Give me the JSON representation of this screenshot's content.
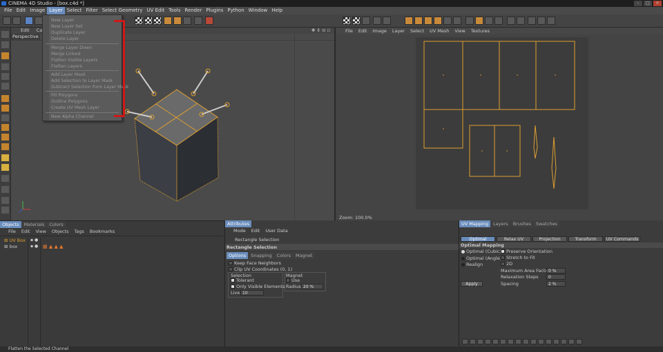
{
  "app": {
    "title": "CINEMA 4D Studio - [box.c4d *]"
  },
  "menubar": [
    "File",
    "Edit",
    "Image",
    "Layer",
    "Select",
    "Filter",
    "Select Geometry",
    "UV Edit",
    "Tools",
    "Render",
    "Plugins",
    "Python",
    "Window",
    "Help"
  ],
  "viewport": {
    "menu": [
      "Edit",
      "Cam"
    ],
    "label": "Perspective"
  },
  "layer_menu": {
    "items": [
      "New Layer",
      "New Layer Set",
      "Duplicate Layer",
      "Delete Layer",
      "Merge Layer Down",
      "Merge Linked",
      "Flatten Visible Layers",
      "Flatten Layers",
      "Add Layer Mask",
      "Add Selection to Layer Mask",
      "Subtract Selection from Layer Mask",
      "Fill Polygons",
      "Outline Polygons",
      "Create UV Mesh Layer",
      "New Alpha Channel"
    ]
  },
  "uv_view": {
    "menu": [
      "File",
      "Edit",
      "Image",
      "Layer",
      "Select",
      "UV Mesh",
      "View",
      "Textures"
    ],
    "zoom": "Zoom: 100.0%"
  },
  "objects_panel": {
    "tabs": [
      "Objects",
      "Materials",
      "Colors"
    ],
    "menu": [
      "File",
      "Edit",
      "View",
      "Objects",
      "Tags",
      "Bookmarks"
    ],
    "rows": [
      "UV Box",
      "box"
    ]
  },
  "attributes_panel": {
    "tab": "Attributes",
    "menu": [
      "Mode",
      "Edit",
      "User Data"
    ],
    "tool_name": "Rectangle Selection",
    "section_title": "Rectangle Selection",
    "subtabs": [
      "Options",
      "Snapping",
      "Colors",
      "Magnet"
    ],
    "keep_face_neighbors": "Keep Face Neighbors",
    "clip_uv": "Clip UV Coordinates (0, 1)",
    "selection_group": "Selection",
    "tolerant": "Tolerant",
    "only_visible": "Only Visible Elements",
    "live_label": "Live",
    "live_value": "10",
    "magnet_group": "Magnet",
    "use_label": "Use",
    "radius_label": "Radius",
    "radius_value": "20 %"
  },
  "uv_mapping_panel": {
    "tabs": [
      "UV Mapping",
      "Layers",
      "Brushes",
      "Swatches"
    ],
    "subtabs": [
      "Optimal Mapping",
      "Relax UV",
      "Projection",
      "Transform",
      "UV Commands"
    ],
    "section_title": "Optimal Mapping",
    "options": [
      "Optimal (Cubic)",
      "Optimal (Angle)",
      "Realign"
    ],
    "preserve_orientation": "Preserve Orientation",
    "stretch_to_fit": "Stretch to Fit",
    "two_d": "2D",
    "max_area_factor_label": "Maximum Area Factor",
    "max_area_factor_value": "0 %",
    "relaxation_steps_label": "Relaxation Steps",
    "relaxation_steps_value": "0",
    "spacing_label": "Spacing",
    "spacing_value": "2 %",
    "apply_label": "Apply"
  },
  "status": "Flatten the Selected Channel",
  "colors": {
    "accent": "#6a8dbc",
    "uv_island": "#e0a030",
    "highlight_red": "#d01818",
    "menu_bg": "#5b5b5b"
  }
}
